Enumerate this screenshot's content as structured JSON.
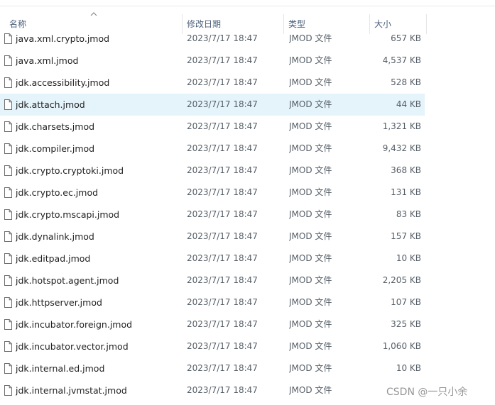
{
  "columns": {
    "name": "名称",
    "date": "修改日期",
    "type": "类型",
    "size": "大小"
  },
  "sort": {
    "column": "name",
    "direction": "ascending",
    "indicator": "chevron-up-icon"
  },
  "selected_file": "jdk.attach.jmod",
  "files": [
    {
      "name": "java.xml.crypto.jmod",
      "date": "2023/7/17 18:47",
      "type": "JMOD 文件",
      "size": "657 KB"
    },
    {
      "name": "java.xml.jmod",
      "date": "2023/7/17 18:47",
      "type": "JMOD 文件",
      "size": "4,537 KB"
    },
    {
      "name": "jdk.accessibility.jmod",
      "date": "2023/7/17 18:47",
      "type": "JMOD 文件",
      "size": "528 KB"
    },
    {
      "name": "jdk.attach.jmod",
      "date": "2023/7/17 18:47",
      "type": "JMOD 文件",
      "size": "44 KB"
    },
    {
      "name": "jdk.charsets.jmod",
      "date": "2023/7/17 18:47",
      "type": "JMOD 文件",
      "size": "1,321 KB"
    },
    {
      "name": "jdk.compiler.jmod",
      "date": "2023/7/17 18:47",
      "type": "JMOD 文件",
      "size": "9,432 KB"
    },
    {
      "name": "jdk.crypto.cryptoki.jmod",
      "date": "2023/7/17 18:47",
      "type": "JMOD 文件",
      "size": "368 KB"
    },
    {
      "name": "jdk.crypto.ec.jmod",
      "date": "2023/7/17 18:47",
      "type": "JMOD 文件",
      "size": "131 KB"
    },
    {
      "name": "jdk.crypto.mscapi.jmod",
      "date": "2023/7/17 18:47",
      "type": "JMOD 文件",
      "size": "83 KB"
    },
    {
      "name": "jdk.dynalink.jmod",
      "date": "2023/7/17 18:47",
      "type": "JMOD 文件",
      "size": "157 KB"
    },
    {
      "name": "jdk.editpad.jmod",
      "date": "2023/7/17 18:47",
      "type": "JMOD 文件",
      "size": "10 KB"
    },
    {
      "name": "jdk.hotspot.agent.jmod",
      "date": "2023/7/17 18:47",
      "type": "JMOD 文件",
      "size": "2,205 KB"
    },
    {
      "name": "jdk.httpserver.jmod",
      "date": "2023/7/17 18:47",
      "type": "JMOD 文件",
      "size": "107 KB"
    },
    {
      "name": "jdk.incubator.foreign.jmod",
      "date": "2023/7/17 18:47",
      "type": "JMOD 文件",
      "size": "325 KB"
    },
    {
      "name": "jdk.incubator.vector.jmod",
      "date": "2023/7/17 18:47",
      "type": "JMOD 文件",
      "size": "1,060 KB"
    },
    {
      "name": "jdk.internal.ed.jmod",
      "date": "2023/7/17 18:47",
      "type": "JMOD 文件",
      "size": "10 KB"
    },
    {
      "name": "jdk.internal.jvmstat.jmod",
      "date": "2023/7/17 18:47",
      "type": "JMOD 文件",
      "size": ""
    }
  ],
  "watermark": "CSDN @一只小余",
  "colors": {
    "selection": "#e5f3fb",
    "header_text": "#4c607a",
    "secondary_text": "#555e66"
  }
}
